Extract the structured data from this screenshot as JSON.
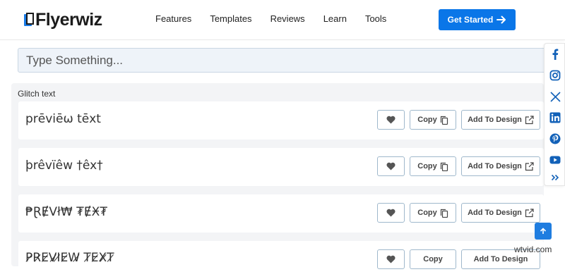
{
  "header": {
    "logo_text": "Flyerwiz",
    "nav": [
      "Features",
      "Templates",
      "Reviews",
      "Learn",
      "Tools"
    ],
    "cta_label": "Get Started"
  },
  "search": {
    "placeholder": "Type Something..."
  },
  "panel": {
    "title": "Glitch text",
    "cards": [
      {
        "text": "prēviēω tēxt"
      },
      {
        "text": "þrêvïêw †êx†"
      },
      {
        "text": "₱ⱤɆVł₩ ₮ɆӾ₮"
      },
      {
        "text": "P̷R̷E̷V̷I̷E̷W̷ T̷E̷X̷T̷"
      }
    ],
    "copy_label": "Copy",
    "add_label": "Add To Design"
  },
  "social": [
    "facebook-icon",
    "instagram-icon",
    "x-icon",
    "linkedin-icon",
    "pinterest-icon",
    "youtube-icon",
    "more-icon"
  ],
  "watermark": "wtvid.com",
  "colors": {
    "accent": "#0a76e8",
    "panel_bg": "#f3f4f6",
    "search_bg": "#eef3f9"
  }
}
